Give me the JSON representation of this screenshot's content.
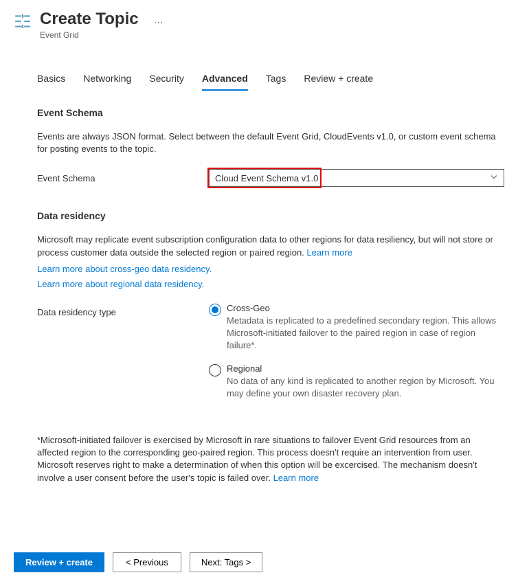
{
  "header": {
    "title": "Create Topic",
    "subtitle": "Event Grid"
  },
  "tabs": [
    {
      "label": "Basics",
      "active": false
    },
    {
      "label": "Networking",
      "active": false
    },
    {
      "label": "Security",
      "active": false
    },
    {
      "label": "Advanced",
      "active": true
    },
    {
      "label": "Tags",
      "active": false
    },
    {
      "label": "Review + create",
      "active": false
    }
  ],
  "eventSchema": {
    "title": "Event Schema",
    "description": "Events are always JSON format. Select between the default Event Grid, CloudEvents v1.0, or custom event schema for posting events to the topic.",
    "label": "Event Schema",
    "selected": "Cloud Event Schema v1.0"
  },
  "dataResidency": {
    "title": "Data residency",
    "description": "Microsoft may replicate event subscription configuration data to other regions for data resiliency, but will not store or process customer data outside the selected region or paired region. ",
    "learnMore": "Learn more",
    "link1": "Learn more about cross-geo data residency.",
    "link2": "Learn more about regional data residency.",
    "typeLabel": "Data residency type",
    "options": [
      {
        "label": "Cross-Geo",
        "desc": "Metadata is replicated to a predefined secondary region. This allows Microsoft-initiated failover to the paired region in case of region failure*.",
        "selected": true
      },
      {
        "label": "Regional",
        "desc": "No data of any kind is replicated to another region by Microsoft. You may define your own disaster recovery plan.",
        "selected": false
      }
    ],
    "footnote": "*Microsoft-initiated failover is exercised by Microsoft in rare situations to failover Event Grid resources from an affected region to the corresponding geo-paired region. This process doesn't require an intervention from user. Microsoft reserves right to make a determination of when this option will be excercised. The mechanism doesn't involve a user consent before the user's topic is failed over. ",
    "footnoteLink": "Learn more"
  },
  "footer": {
    "reviewCreate": "Review + create",
    "previous": "< Previous",
    "next": "Next: Tags >"
  }
}
